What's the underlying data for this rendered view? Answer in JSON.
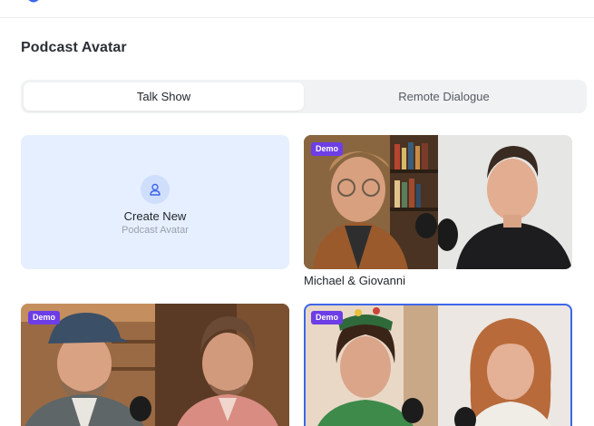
{
  "page": {
    "title": "Podcast Avatar"
  },
  "tabs": [
    {
      "label": "Talk Show",
      "active": true
    },
    {
      "label": "Remote Dialogue",
      "active": false
    }
  ],
  "create_card": {
    "title": "Create New",
    "subtitle": "Podcast Avatar",
    "icon": "person-icon"
  },
  "cards": [
    {
      "badge": "Demo",
      "label": "Michael & Giovanni",
      "selected": false
    },
    {
      "badge": "Demo",
      "label": "",
      "selected": false
    },
    {
      "badge": "Demo",
      "label": "",
      "selected": true
    }
  ],
  "colors": {
    "accent": "#3d67e8",
    "badge": "#6d3ee6",
    "create_bg": "#e6efff"
  }
}
